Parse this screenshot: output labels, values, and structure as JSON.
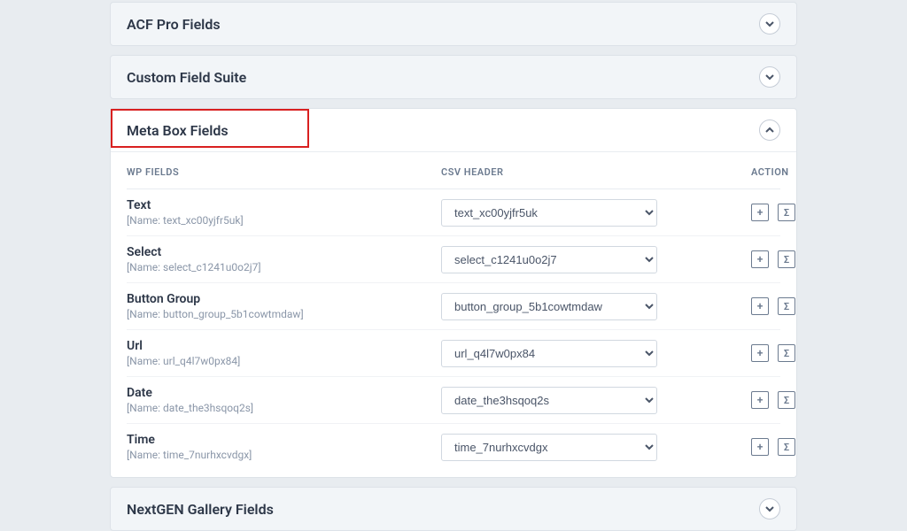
{
  "panels": {
    "acf": {
      "title": "ACF Pro Fields"
    },
    "cfs": {
      "title": "Custom Field Suite"
    },
    "metabox": {
      "title": "Meta Box Fields"
    },
    "nextgen": {
      "title": "NextGEN Gallery Fields"
    }
  },
  "headers": {
    "wp": "WP FIELDS",
    "csv": "CSV HEADER",
    "action": "ACTION"
  },
  "fields": [
    {
      "label": "Text",
      "meta": "[Name: text_xc00yjfr5uk]",
      "value": "text_xc00yjfr5uk"
    },
    {
      "label": "Select",
      "meta": "[Name: select_c1241u0o2j7]",
      "value": "select_c1241u0o2j7"
    },
    {
      "label": "Button Group",
      "meta": "[Name: button_group_5b1cowtmdaw]",
      "value": "button_group_5b1cowtmdaw"
    },
    {
      "label": "Url",
      "meta": "[Name: url_q4l7w0px84]",
      "value": "url_q4l7w0px84"
    },
    {
      "label": "Date",
      "meta": "[Name: date_the3hsqoq2s]",
      "value": "date_the3hsqoq2s"
    },
    {
      "label": "Time",
      "meta": "[Name: time_7nurhxcvdgx]",
      "value": "time_7nurhxcvdgx"
    }
  ],
  "icons": {
    "plus": "+",
    "sigma": "Σ"
  }
}
